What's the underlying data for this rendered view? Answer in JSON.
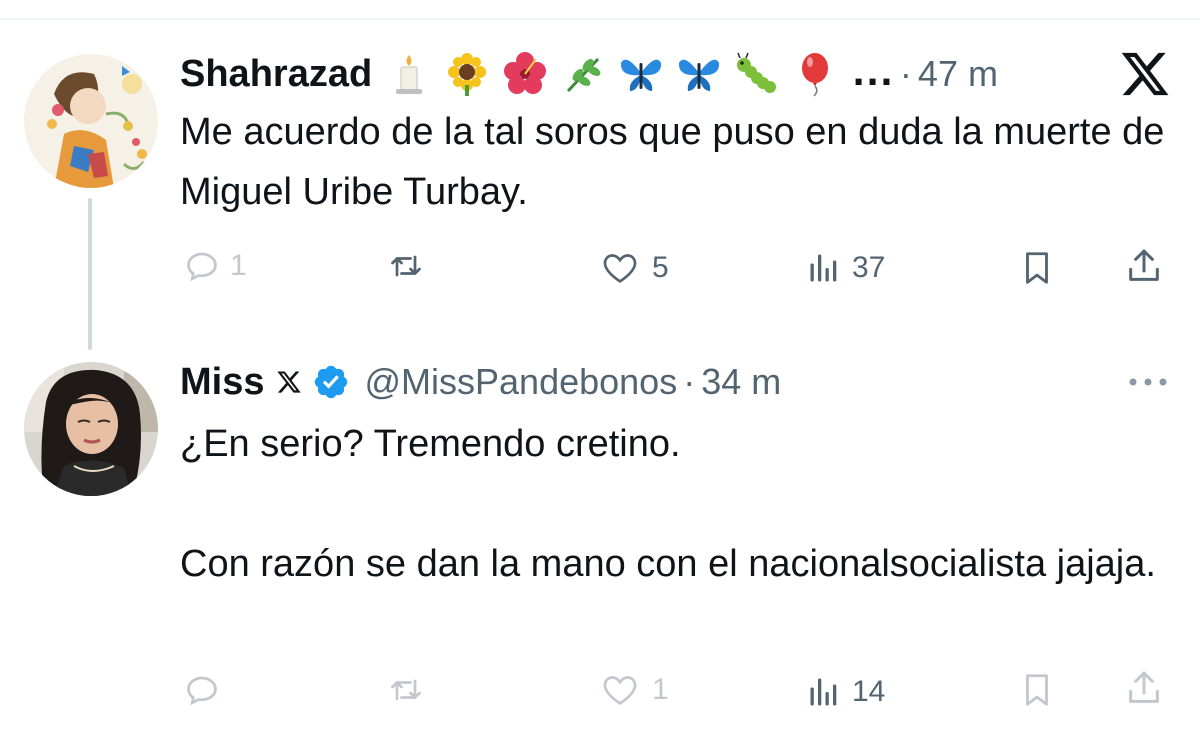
{
  "tweets": [
    {
      "author": "Shahrazad",
      "emojis": [
        "candle-emoji",
        "sunflower-emoji",
        "hibiscus-emoji",
        "herb-emoji",
        "butterfly-emoji",
        "butterfly-emoji",
        "caterpillar-emoji",
        "balloon-emoji"
      ],
      "ellipsis": "...",
      "time": "47 m",
      "text": [
        "Me acuerdo de la tal soros que puso en duda la muerte de Miguel Uribe Turbay."
      ],
      "actions": {
        "replies": "1",
        "retweets": "",
        "likes": "5",
        "views": "37"
      }
    },
    {
      "author": "Miss",
      "handle": "@MissPandebonos",
      "time": "34 m",
      "text": [
        "¿En serio? Tremendo cretino.",
        "Con razón se dan la mano con el nacionalsocialista jajaja."
      ],
      "actions": {
        "replies": "",
        "retweets": "",
        "likes": "1",
        "views": "14"
      }
    }
  ],
  "separator": "·",
  "colors": {
    "text": "#0f1419",
    "secondary": "#536471",
    "verified": "#1d9bf0",
    "thread_line": "#cfd9de"
  }
}
